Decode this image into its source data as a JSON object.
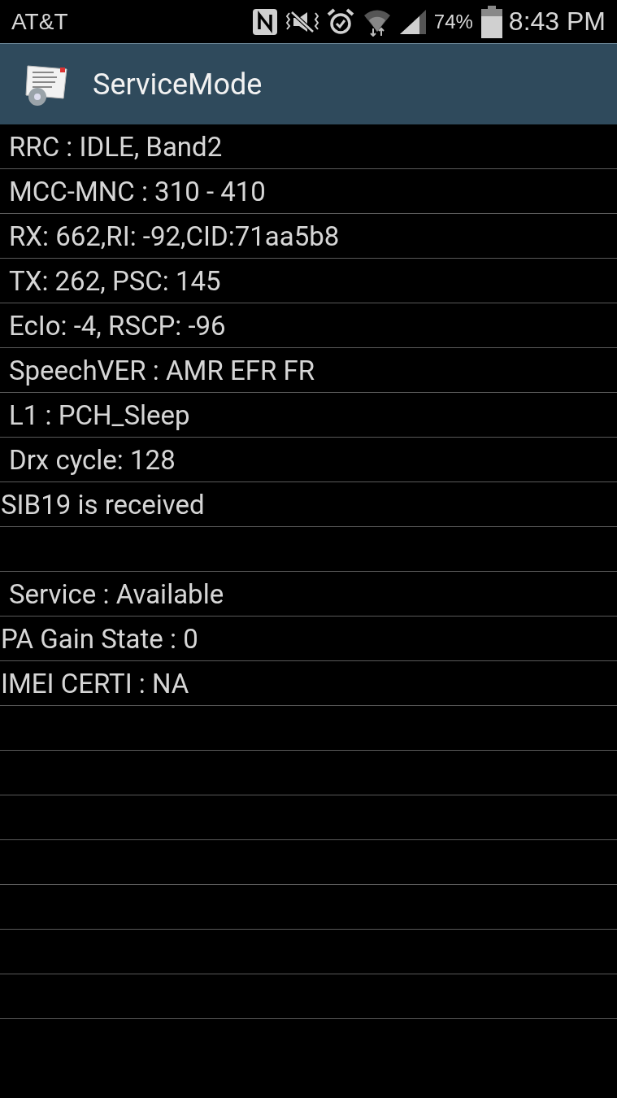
{
  "status_bar": {
    "carrier": "AT&T",
    "battery_percent": "74%",
    "time": "8:43 PM"
  },
  "app_bar": {
    "title": "ServiceMode"
  },
  "rows": [
    {
      "kind": "indented",
      "text": "RRC : IDLE, Band2"
    },
    {
      "kind": "indented",
      "text": "MCC-MNC : 310 - 410"
    },
    {
      "kind": "indented",
      "text": "RX: 662,RI: -92,CID:71aa5b8"
    },
    {
      "kind": "indented",
      "text": "TX: 262, PSC: 145"
    },
    {
      "kind": "indented",
      "text": "EcIo: -4, RSCP: -96"
    },
    {
      "kind": "indented",
      "text": "SpeechVER : AMR EFR FR"
    },
    {
      "kind": "indented",
      "text": "L1 : PCH_Sleep"
    },
    {
      "kind": "indented",
      "text": "Drx cycle: 128"
    },
    {
      "kind": "plain",
      "text": "SIB19 is received"
    },
    {
      "kind": "blank"
    },
    {
      "kind": "indented",
      "text": "Service : Available"
    },
    {
      "kind": "plain",
      "text": "PA Gain State : 0"
    },
    {
      "kind": "plain",
      "text": "IMEI CERTI : NA"
    },
    {
      "kind": "blank"
    },
    {
      "kind": "blank"
    },
    {
      "kind": "blank"
    },
    {
      "kind": "blank"
    },
    {
      "kind": "blank"
    },
    {
      "kind": "blank"
    },
    {
      "kind": "blank"
    }
  ]
}
